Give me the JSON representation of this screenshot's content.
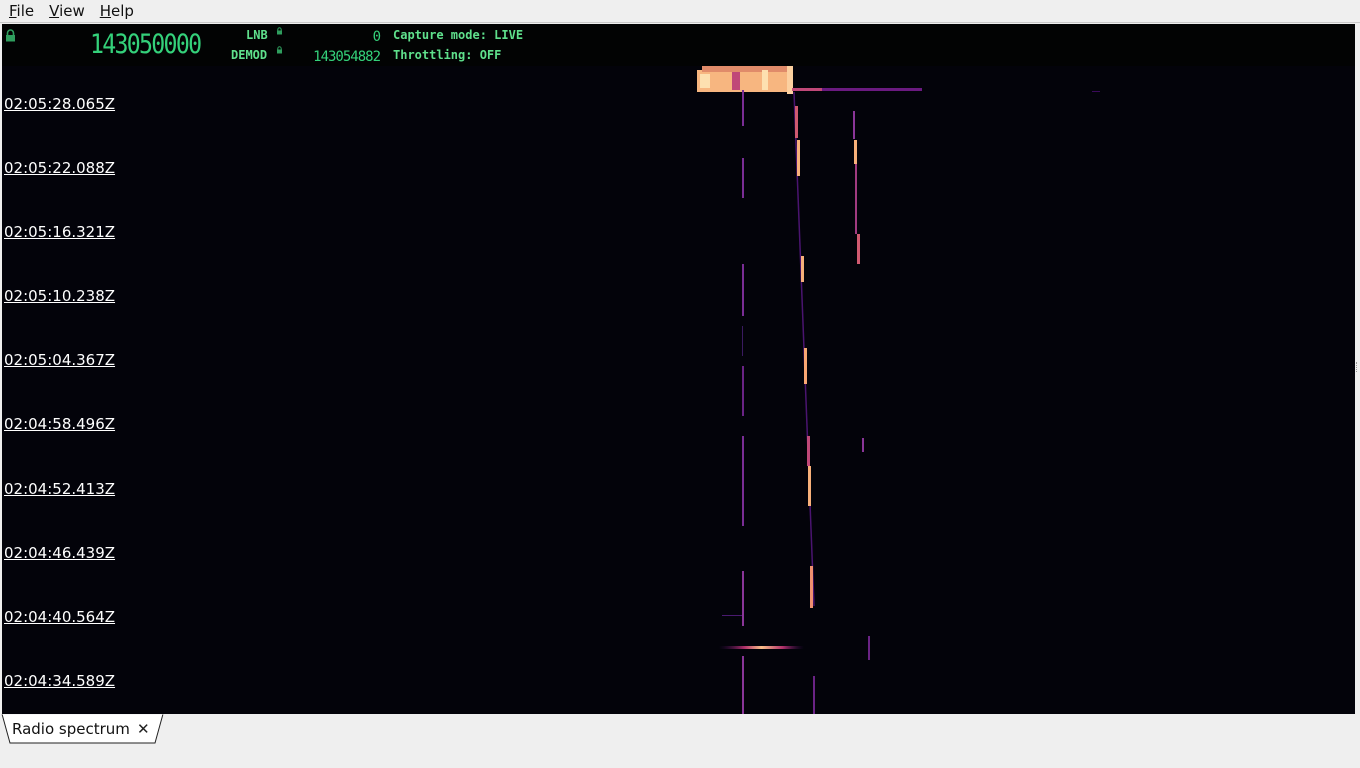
{
  "menu": {
    "file": {
      "mnemonic": "F",
      "rest": "ile"
    },
    "view": {
      "mnemonic": "V",
      "rest": "iew"
    },
    "help": {
      "mnemonic": "H",
      "rest": "elp"
    }
  },
  "status": {
    "main_frequency": "143050000",
    "lnb_label": "LNB",
    "lnb_value": "0",
    "demod_label": "DEMOD",
    "demod_value": "143054882",
    "capture_mode": "Capture mode: LIVE",
    "throttling": "Throttling: OFF",
    "text_color": "#34d17a"
  },
  "waterfall": {
    "background": "#03030a",
    "colormap": "magma",
    "timestamps": [
      "02:05:28.065Z",
      "02:05:22.088Z",
      "02:05:16.321Z",
      "02:05:10.238Z",
      "02:05:04.367Z",
      "02:04:58.496Z",
      "02:04:52.413Z",
      "02:04:46.439Z",
      "02:04:40.564Z",
      "02:04:34.589Z"
    ]
  },
  "tabs": [
    {
      "label": "Radio spectrum",
      "close_icon": "close-icon"
    }
  ]
}
